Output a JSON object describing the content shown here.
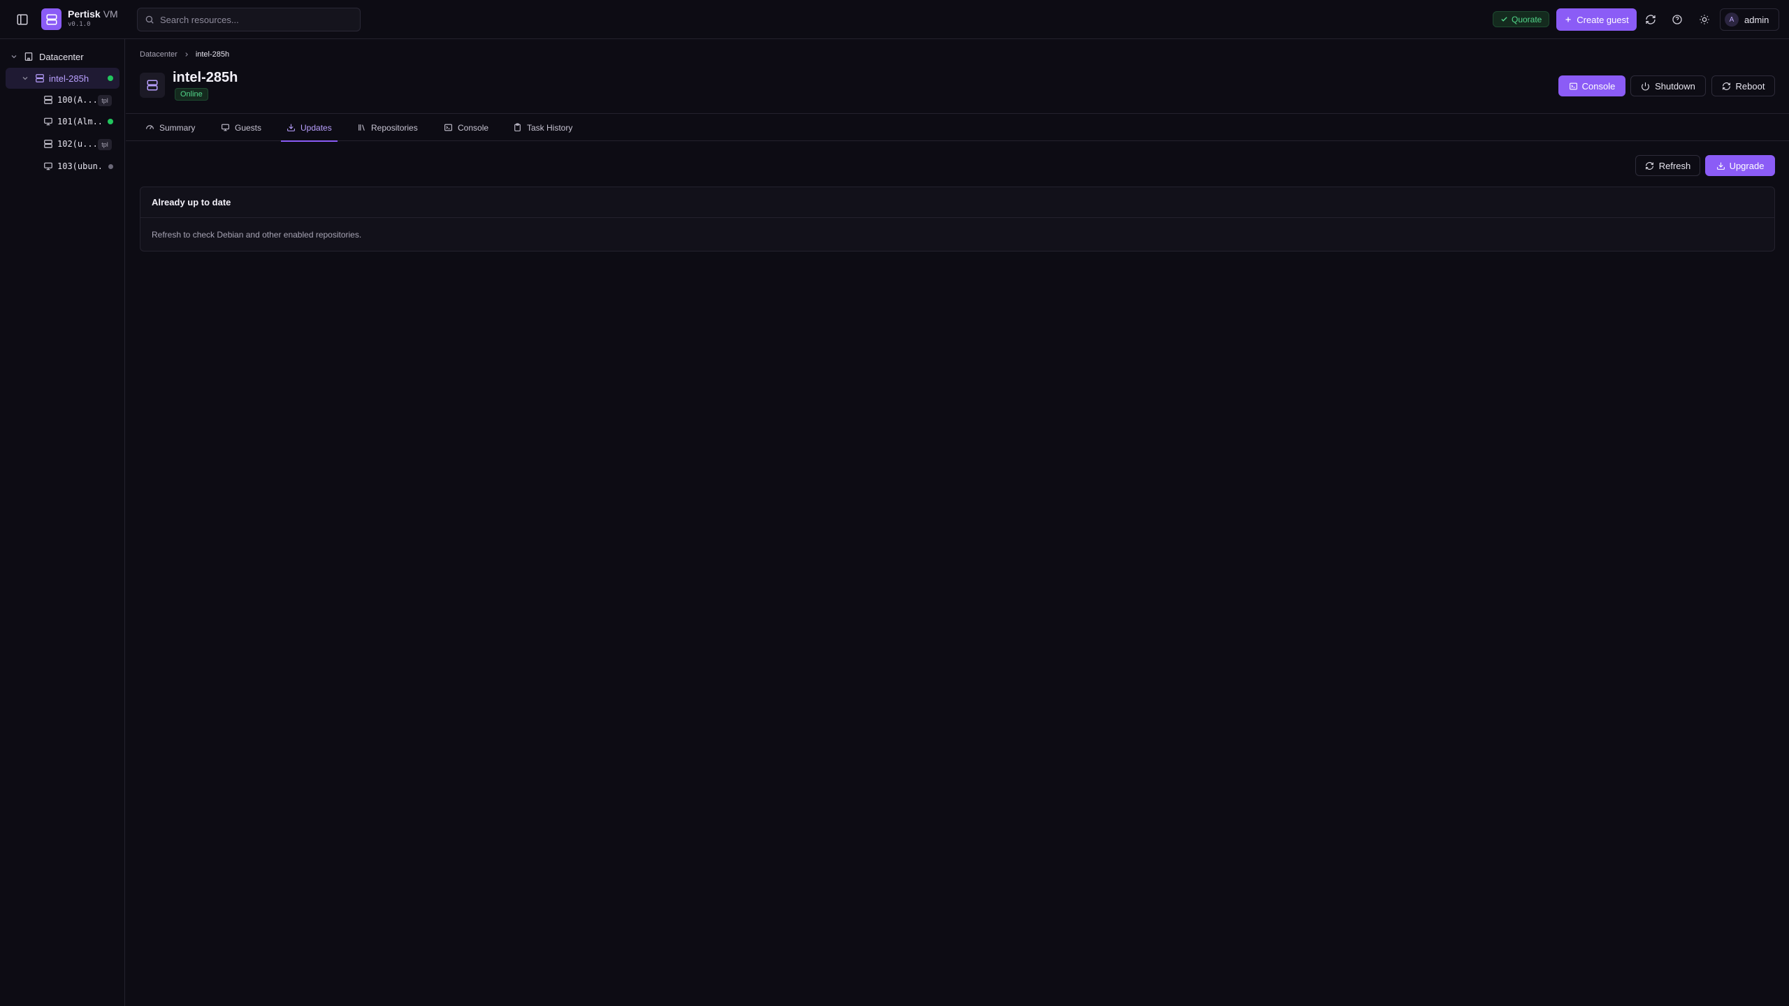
{
  "app": {
    "brand_name": "Pertisk",
    "brand_suffix": "VM",
    "version": "v0.1.0"
  },
  "search": {
    "placeholder": "Search resources..."
  },
  "topbar": {
    "quorate_label": "Quorate",
    "create_guest_label": "Create guest",
    "user_initial": "A",
    "user_name": "admin"
  },
  "tree": {
    "datacenter_label": "Datacenter",
    "node": {
      "label": "intel-285h",
      "status": "online"
    },
    "guests": [
      {
        "label": "100(A...",
        "kind": "template",
        "badge": "tpl"
      },
      {
        "label": "101(Alm...",
        "kind": "vm",
        "status": "running"
      },
      {
        "label": "102(u...",
        "kind": "template",
        "badge": "tpl"
      },
      {
        "label": "103(ubun...",
        "kind": "vm",
        "status": "stopped"
      }
    ]
  },
  "breadcrumb": {
    "root": "Datacenter",
    "current": "intel-285h"
  },
  "header": {
    "title": "intel-285h",
    "status": "Online",
    "console_label": "Console",
    "shutdown_label": "Shutdown",
    "reboot_label": "Reboot"
  },
  "tabs": [
    {
      "label": "Summary",
      "icon": "gauge-icon"
    },
    {
      "label": "Guests",
      "icon": "monitor-icon"
    },
    {
      "label": "Updates",
      "icon": "download-icon",
      "active": true
    },
    {
      "label": "Repositories",
      "icon": "library-icon"
    },
    {
      "label": "Console",
      "icon": "terminal-icon"
    },
    {
      "label": "Task History",
      "icon": "clipboard-icon"
    }
  ],
  "actions": {
    "refresh_label": "Refresh",
    "upgrade_label": "Upgrade"
  },
  "updates_panel": {
    "title": "Already up to date",
    "message": "Refresh to check Debian and other enabled repositories."
  },
  "colors": {
    "background": "#0d0c14",
    "accent": "#8b5cf6",
    "online_green": "#22c55e",
    "stopped_gray": "#6b6878"
  }
}
